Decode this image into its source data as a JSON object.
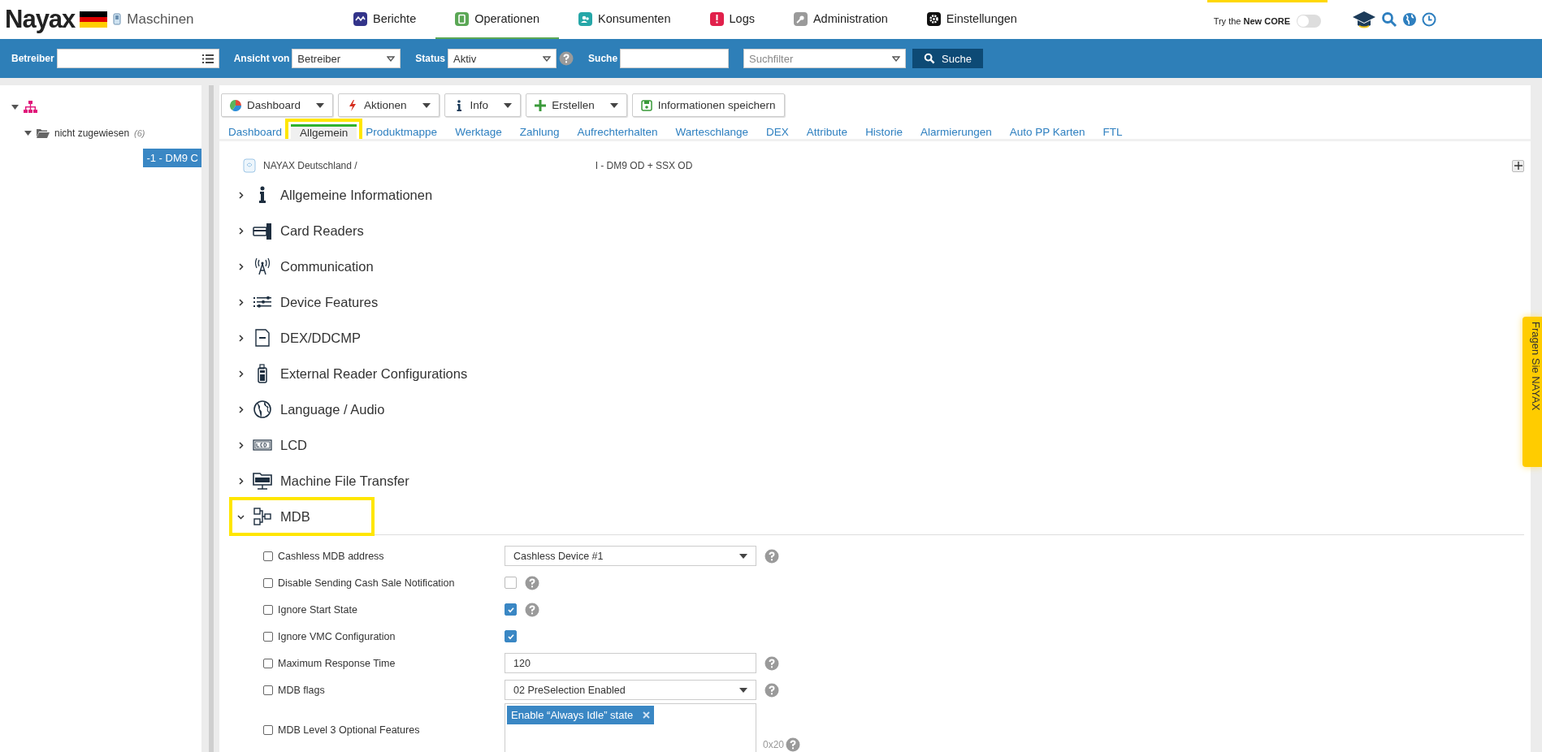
{
  "header": {
    "logo": "Nayax",
    "section": "Maschinen",
    "nav": [
      {
        "label": "Berichte",
        "color": "#33348a",
        "selected": false
      },
      {
        "label": "Operationen",
        "color": "#5aa755",
        "selected": true
      },
      {
        "label": "Konsumenten",
        "color": "#26a7a8",
        "selected": false
      },
      {
        "label": "Logs",
        "color": "#e1204b",
        "selected": false
      },
      {
        "label": "Administration",
        "color": "#9a9a9a",
        "selected": false
      },
      {
        "label": "Einstellungen",
        "color": "#111111",
        "selected": false
      }
    ],
    "core_promo": "Try the **New CORE**",
    "core_toggle": {
      "on": false
    }
  },
  "filter_bar": {
    "fields": [
      {
        "kind": "input",
        "label": "Betreiber"
      },
      {
        "kind": "select",
        "label": "Ansicht von",
        "value": "Betreiber",
        "help": false
      },
      {
        "kind": "select",
        "label": "Status",
        "value": "Aktiv",
        "help": true
      },
      {
        "kind": "search",
        "label": "Suche"
      },
      {
        "kind": "select",
        "placeholder": "Suchfilter",
        "help": false
      }
    ],
    "button": "Suche"
  },
  "tree": [
    {
      "expanded": true,
      "children": [
        {
          "label": "nicht zugewiesen",
          "count": "(6)",
          "expanded": true,
          "children": [
            {
              "label": "-1 - DM9 C",
              "selected": true
            }
          ]
        }
      ]
    }
  ],
  "toolbar": [
    {
      "label": "Dashboard",
      "dropdown": true
    },
    {
      "label": "Aktionen",
      "dropdown": true
    },
    {
      "label": "Info",
      "dropdown": true
    },
    {
      "label": "Erstellen",
      "dropdown": true
    },
    {
      "label": "Informationen speichern",
      "dropdown": false
    }
  ],
  "tabs": [
    {
      "label": "Dashboard",
      "selected": false,
      "highlighted": false
    },
    {
      "label": "Allgemein",
      "selected": true,
      "highlighted": true
    },
    {
      "label": "Produktmappe",
      "selected": false,
      "highlighted": false
    },
    {
      "label": "Werktage",
      "selected": false,
      "highlighted": false
    },
    {
      "label": "Zahlung",
      "selected": false,
      "highlighted": false
    },
    {
      "label": "Aufrechterhalten",
      "selected": false,
      "highlighted": false
    },
    {
      "label": "Warteschlange",
      "selected": false,
      "highlighted": false
    },
    {
      "label": "DEX",
      "selected": false,
      "highlighted": false
    },
    {
      "label": "Attribute",
      "selected": false,
      "highlighted": false
    },
    {
      "label": "Historie",
      "selected": false,
      "highlighted": false
    },
    {
      "label": "Alarmierungen",
      "selected": false,
      "highlighted": false
    },
    {
      "label": "Auto PP Karten",
      "selected": false,
      "highlighted": false
    },
    {
      "label": "FTL",
      "selected": false,
      "highlighted": false
    }
  ],
  "breadcrumb": {
    "path": "NAYAX Deutschland /",
    "machine": "I - DM9 OD + SSX OD"
  },
  "sections": [
    {
      "title": "Allgemeine Informationen",
      "expanded": false,
      "highlighted": false
    },
    {
      "title": "Card Readers",
      "expanded": false,
      "highlighted": false
    },
    {
      "title": "Communication",
      "expanded": false,
      "highlighted": false
    },
    {
      "title": "Device Features",
      "expanded": false,
      "highlighted": false
    },
    {
      "title": "DEX/DDCMP",
      "expanded": false,
      "highlighted": false
    },
    {
      "title": "External Reader Configurations",
      "expanded": false,
      "highlighted": false
    },
    {
      "title": "Language / Audio",
      "expanded": false,
      "highlighted": false
    },
    {
      "title": "LCD",
      "expanded": false,
      "highlighted": false
    },
    {
      "title": "Machine File Transfer",
      "expanded": false,
      "highlighted": false
    },
    {
      "title": "MDB",
      "expanded": true,
      "highlighted": true,
      "settings": [
        {
          "label": "Cashless MDB address",
          "enabled": false,
          "kind": "select",
          "value": "Cashless Device #1",
          "help": true
        },
        {
          "label": "Disable Sending Cash Sale Notification",
          "enabled": false,
          "kind": "checkbox",
          "checked": false,
          "help": true
        },
        {
          "label": "Ignore Start State",
          "enabled": false,
          "kind": "checkbox",
          "checked": true,
          "help": true
        },
        {
          "label": "Ignore VMC Configuration",
          "enabled": false,
          "kind": "checkbox",
          "checked": true,
          "help": false
        },
        {
          "label": "Maximum Response Time",
          "enabled": false,
          "kind": "text",
          "value": "120",
          "help": true
        },
        {
          "label": "MDB flags",
          "enabled": false,
          "kind": "select",
          "value": "02 PreSelection Enabled",
          "help": true
        },
        {
          "label": "MDB Level 3 Optional Features",
          "enabled": false,
          "kind": "tags",
          "tags": [
            "Enable “Always Idle” state"
          ],
          "hint": "0x20",
          "help": true
        }
      ]
    }
  ],
  "feedback_tab": "Fragen Sie NAYAX"
}
